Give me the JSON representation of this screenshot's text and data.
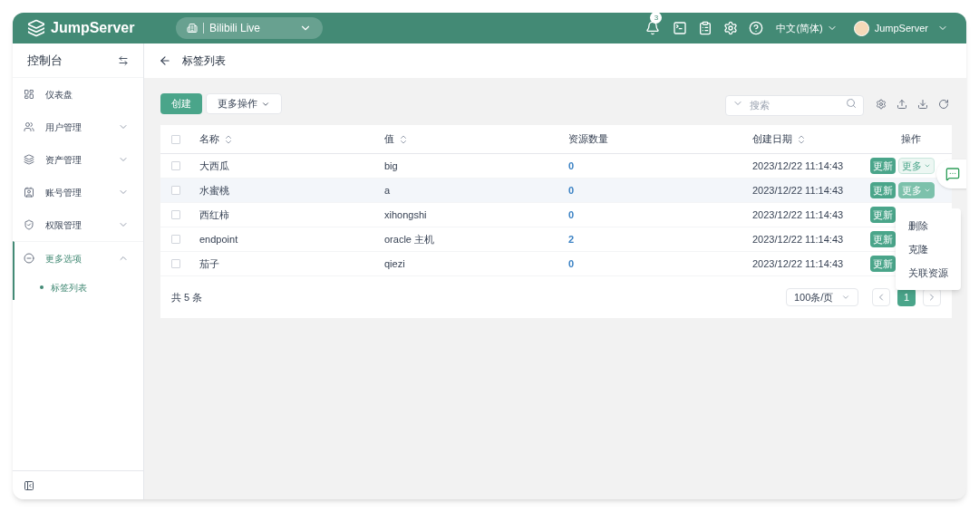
{
  "brand": "JumpServer",
  "org_selector": {
    "label": "Bilibili Live"
  },
  "header": {
    "notification_count": "3",
    "language": "中文(简体)",
    "user": "JumpServer"
  },
  "sidebar": {
    "title": "控制台",
    "items": [
      {
        "label": "仪表盘",
        "kind": "link",
        "selected": false
      },
      {
        "label": "用户管理",
        "kind": "group",
        "expanded": false,
        "selected": false
      },
      {
        "label": "资产管理",
        "kind": "group",
        "expanded": false,
        "selected": false
      },
      {
        "label": "账号管理",
        "kind": "group",
        "expanded": false,
        "selected": false
      },
      {
        "label": "权限管理",
        "kind": "group",
        "expanded": false,
        "selected": false
      },
      {
        "label": "更多选项",
        "kind": "group",
        "expanded": true,
        "selected": true,
        "children": [
          {
            "label": "标签列表",
            "selected": true
          }
        ]
      }
    ]
  },
  "page": {
    "title": "标签列表"
  },
  "toolbar": {
    "create": "创建",
    "more_actions": "更多操作",
    "search": {
      "placeholder": "搜索"
    }
  },
  "table": {
    "select_all_checked": false,
    "columns": [
      {
        "label": "名称",
        "sortable": true
      },
      {
        "label": "值",
        "sortable": true
      },
      {
        "label": "资源数量",
        "sortable": false
      },
      {
        "label": "创建日期",
        "sortable": true
      },
      {
        "label": "操作",
        "sortable": false
      }
    ],
    "rows": [
      {
        "checked": false,
        "name": "大西瓜",
        "value": "big",
        "count": "0",
        "date": "2023/12/22 11:14:43",
        "hovered": false,
        "update": "更新",
        "more": "更多",
        "more_open": false
      },
      {
        "checked": false,
        "name": "水蜜桃",
        "value": "a",
        "count": "0",
        "date": "2023/12/22 11:14:43",
        "hovered": true,
        "update": "更新",
        "more": "更多",
        "more_open": true
      },
      {
        "checked": false,
        "name": "西红柿",
        "value": "xihongshi",
        "count": "0",
        "date": "2023/12/22 11:14:43",
        "hovered": false,
        "update": "更新"
      },
      {
        "checked": false,
        "name": "endpoint",
        "value": "oracle 主机",
        "count": "2",
        "date": "2023/12/22 11:14:43",
        "hovered": false,
        "update": "更新"
      },
      {
        "checked": false,
        "name": "茄子",
        "value": "qiezi",
        "count": "0",
        "date": "2023/12/22 11:14:43",
        "hovered": false,
        "update": "更新"
      }
    ]
  },
  "dropdown_menu": [
    "删除",
    "克隆",
    "关联资源"
  ],
  "footer": {
    "total": "共 5 条",
    "page_size": "100条/页",
    "pages": [
      {
        "label": "1",
        "selected": true
      }
    ]
  }
}
